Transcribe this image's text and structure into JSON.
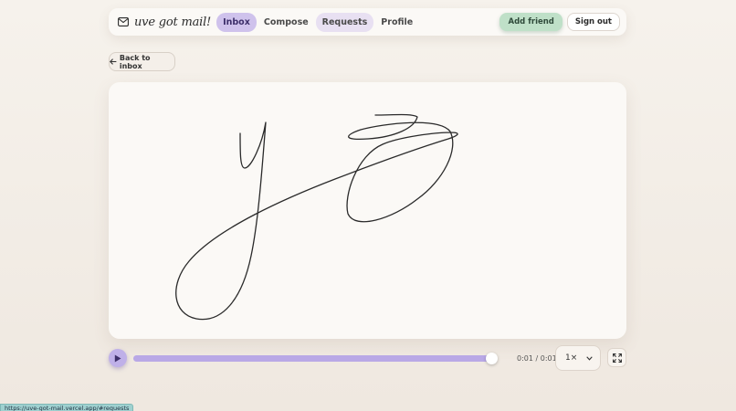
{
  "app": {
    "name": "uve got mail!",
    "icon": "mail-icon"
  },
  "nav": {
    "items": [
      {
        "label": "Inbox",
        "state": "active"
      },
      {
        "label": "Compose",
        "state": "normal"
      },
      {
        "label": "Requests",
        "state": "hover"
      },
      {
        "label": "Profile",
        "state": "normal"
      }
    ],
    "add_friend": "Add friend",
    "sign_out": "Sign out"
  },
  "back": {
    "label": "Back to inbox",
    "icon": "arrow-left-icon"
  },
  "player": {
    "play_icon": "play-icon",
    "progress": 1.0,
    "time": "0:01 / 0:01",
    "speed": "1×",
    "speed_icon": "chevron-down-icon",
    "fullscreen_icon": "fullscreen-icon"
  },
  "status_bar": {
    "url": "https://uve-got-mail.vercel.app/#requests"
  },
  "colors": {
    "accent_purple": "#cfc2ec",
    "accent_green": "#bfe0c8",
    "progress": "#b9a8e6"
  }
}
